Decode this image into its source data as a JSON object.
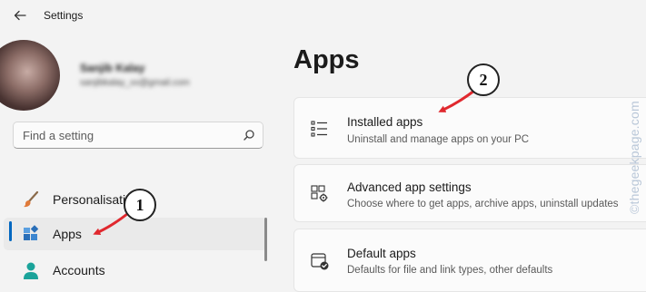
{
  "window": {
    "title": "Settings"
  },
  "user": {
    "name": "Sanjib Kalay",
    "email": "sanjibkalay_xx@gmail.com"
  },
  "search": {
    "placeholder": "Find a setting"
  },
  "sidebar": {
    "items": [
      {
        "label": "Personalisation",
        "icon": "paintbrush-icon"
      },
      {
        "label": "Apps",
        "icon": "apps-icon",
        "selected": true
      },
      {
        "label": "Accounts",
        "icon": "person-icon"
      }
    ]
  },
  "main": {
    "title": "Apps",
    "cards": [
      {
        "title": "Installed apps",
        "description": "Uninstall and manage apps on your PC",
        "icon": "list-icon"
      },
      {
        "title": "Advanced app settings",
        "description": "Choose where to get apps, archive apps, uninstall updates",
        "icon": "app-settings-icon"
      },
      {
        "title": "Default apps",
        "description": "Defaults for file and link types, other defaults",
        "icon": "default-apps-icon"
      }
    ]
  },
  "annotations": {
    "step1": "1",
    "step2": "2"
  },
  "watermark": "©thegeekpage.com",
  "colors": {
    "accent": "#0067c0",
    "arrow": "#e0282e",
    "background": "#f3f3f3",
    "card": "#fbfbfb"
  }
}
